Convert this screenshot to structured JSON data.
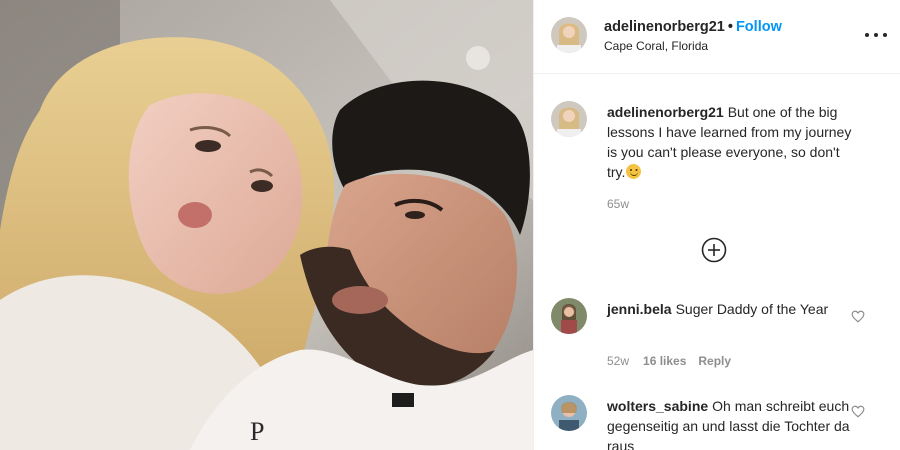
{
  "post": {
    "username": "adelinenorberg21",
    "separator": "•",
    "follow_label": "Follow",
    "location": "Cape Coral, Florida",
    "more_icon": "more-horizontal-icon"
  },
  "caption": {
    "username": "adelinenorberg21",
    "text": "But one of the big lessons I have learned from my journey is you can't please everyone, so don't try.",
    "emoji": "smiling-face-emoji",
    "age": "65w"
  },
  "load_more_icon": "plus-circle-icon",
  "comments": [
    {
      "username": "jenni.bela",
      "text": "Suger Daddy of the Year",
      "age": "52w",
      "likes": "16 likes",
      "reply_label": "Reply"
    },
    {
      "username": "wolters_sabine",
      "text": "Oh man schreibt euch gegenseitig an und lasst die Tochter da raus"
    }
  ],
  "colors": {
    "follow": "#0095f6",
    "text": "#262626",
    "secondary": "#8e8e8e",
    "divider": "#efefef"
  }
}
